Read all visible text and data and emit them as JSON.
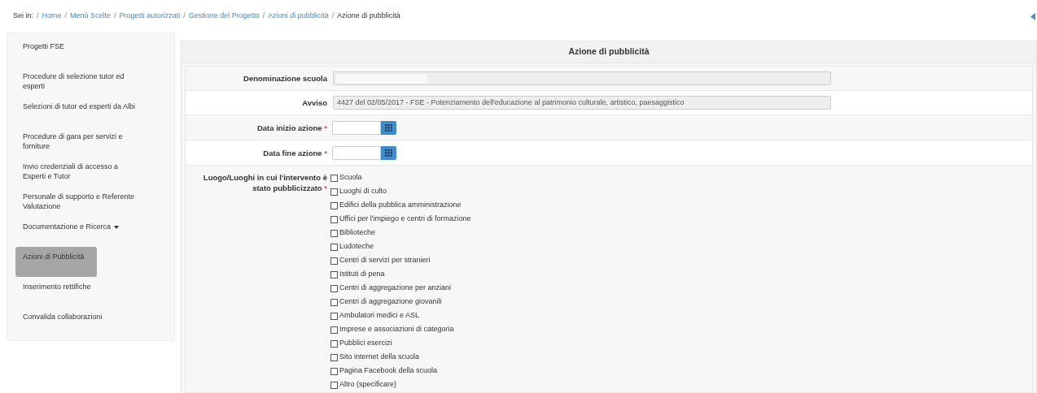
{
  "breadcrumb": {
    "prefix": "Sei in:",
    "links": [
      "Home",
      "Menù Scelte",
      "Progetti autorizzati",
      "Gestione del Progetto",
      "Azioni di pubblicità"
    ],
    "separator": "/",
    "current": "Azione di pubblicità"
  },
  "sidebar": {
    "items": [
      {
        "label": "Progetti FSE",
        "selected": false,
        "dropdown": false
      },
      {
        "label": "Procedure di selezione tutor ed esperti",
        "selected": false,
        "dropdown": false
      },
      {
        "label": "Selezioni di tutor ed esperti da Albi",
        "selected": false,
        "dropdown": false
      },
      {
        "label": "Procedure di gara per servizi e forniture",
        "selected": false,
        "dropdown": false
      },
      {
        "label": "Invio credenziali di accesso a Esperti e Tutor",
        "selected": false,
        "dropdown": false
      },
      {
        "label": "Personale di supporto e Referente Valutazione",
        "selected": false,
        "dropdown": false
      },
      {
        "label": "Documentazione e Ricerca",
        "selected": false,
        "dropdown": true
      },
      {
        "label": "Azioni di Pubblicità",
        "selected": true,
        "dropdown": false
      },
      {
        "label": "Inserimento rettifiche",
        "selected": false,
        "dropdown": false
      },
      {
        "label": "Convalida collaborazioni",
        "selected": false,
        "dropdown": false
      }
    ]
  },
  "form": {
    "title": "Azione di pubblicità",
    "required_mark": "*",
    "fields": [
      {
        "kind": "readonly",
        "label": "Denominazione scuola",
        "required": false,
        "redacted": true
      },
      {
        "kind": "readonly",
        "label": "Avviso",
        "required": false,
        "value": "4427 del 02/05/2017 - FSE - Potenziamento dell'educazione al patrimonio culturale, artistico, paesaggistico",
        "redacted": false
      },
      {
        "kind": "date",
        "label": "Data inizio azione",
        "required": true
      },
      {
        "kind": "date",
        "label": "Data fine azione",
        "required": true
      },
      {
        "kind": "checklist",
        "label": "Luogo/Luoghi in cui l'intervento è stato pubblicizzato",
        "required": true,
        "options": [
          {
            "label": "Scuola",
            "checked": false
          },
          {
            "label": "Luoghi di culto",
            "checked": false
          },
          {
            "label": "Edifici della pubblica amministrazione",
            "checked": false
          },
          {
            "label": "Uffici per l'impiego e centri di formazione",
            "checked": false
          },
          {
            "label": "Biblioteche",
            "checked": false
          },
          {
            "label": "Ludoteche",
            "checked": false
          },
          {
            "label": "Centri di servizi per stranieri",
            "checked": false
          },
          {
            "label": "Istituti di pena",
            "checked": false
          },
          {
            "label": "Centri di aggregazione per anziani",
            "checked": false
          },
          {
            "label": "Centri di aggregazione giovanili",
            "checked": false
          },
          {
            "label": "Ambulatori medici e ASL",
            "checked": false
          },
          {
            "label": "Imprese e associazioni di categoria",
            "checked": false
          },
          {
            "label": "Pubblici esercizi",
            "checked": false
          },
          {
            "label": "Sito internet della scuola",
            "checked": false
          },
          {
            "label": "Pagina Facebook della scuola",
            "checked": false
          },
          {
            "label": "Altro (specificare)",
            "checked": false
          }
        ]
      }
    ]
  }
}
